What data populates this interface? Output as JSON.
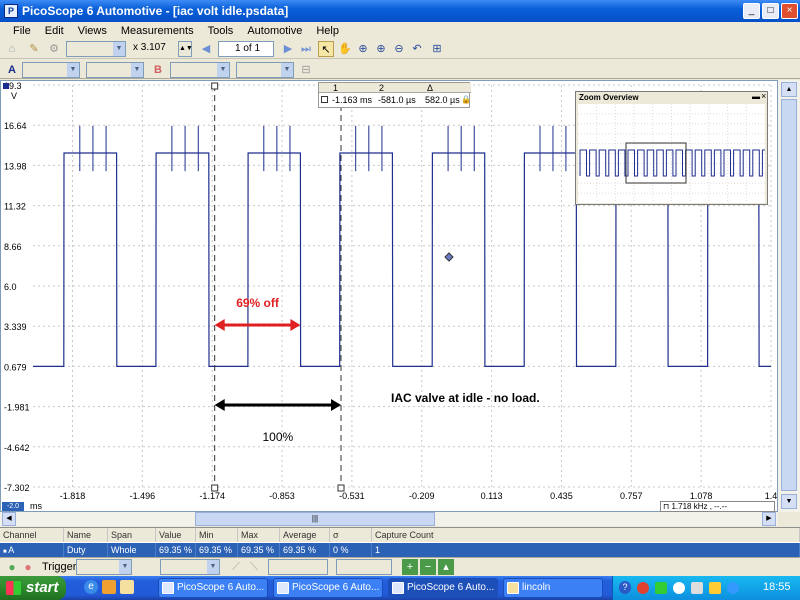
{
  "window": {
    "title": "PicoScope 6 Automotive - [iac volt idle.psdata]",
    "min_label": "_",
    "max_label": "□",
    "close_label": "×"
  },
  "menu": {
    "items": [
      "File",
      "Edit",
      "Views",
      "Measurements",
      "Tools",
      "Automotive",
      "Help"
    ]
  },
  "toolbar": {
    "zoom_value": "x 3.107",
    "page_value": "1 of 1",
    "channel_a": "A",
    "channel_b": "B"
  },
  "plot": {
    "channel_label": "A",
    "unit_label": "V",
    "time_unit": "ms",
    "y_tick_labels": [
      "19.3",
      "16.64",
      "13.98",
      "11.32",
      "8.66",
      "6.0",
      "3.339",
      "0.679",
      "-1.981",
      "-4.642",
      "-7.302"
    ],
    "x_tick_labels": [
      "-1.818",
      "-1.496",
      "-1.174",
      "-0.853",
      "-0.531",
      "-0.209",
      "0.113",
      "0.435",
      "0.757",
      "1.078",
      "1.4"
    ],
    "x_start_label": "-2.0",
    "frequency_readout": "1.718 kHz , --.--",
    "annotation_off": "69% off",
    "annotation_period": "100%",
    "annotation_note": "IAC valve at idle - no load."
  },
  "ruler_panel": {
    "headers": [
      "1",
      "2",
      "Δ"
    ],
    "values": [
      "-1.163 ms",
      "-581.0 µs",
      "582.0 µs"
    ]
  },
  "zoom_overview": {
    "title": "Zoom Overview"
  },
  "measurements_table": {
    "headers": [
      "Channel",
      "Name",
      "Span",
      "Value",
      "Min",
      "Max",
      "Average",
      "σ",
      "Capture Count"
    ],
    "row": [
      "A",
      "Duty Cycle",
      "Whole trace",
      "69.35 %",
      "69.35 %",
      "69.35 %",
      "69.35 %",
      "0 %",
      "1"
    ]
  },
  "trigger": {
    "label": "Trigger"
  },
  "taskbar": {
    "start_label": "start",
    "tasks": [
      "PicoScope 6 Auto...",
      "PicoScope 6 Auto...",
      "PicoScope 6 Auto...",
      "lincoln"
    ],
    "clock": "18:55"
  },
  "chart_data": {
    "type": "line",
    "title": "",
    "xlabel": "ms",
    "ylabel": "V",
    "xlim": [
      -2.0,
      1.4
    ],
    "ylim": [
      -7.302,
      19.3
    ],
    "grid": true,
    "series": [
      {
        "color": "#1f2f8f",
        "x": [
          -2.0,
          -1.858,
          -1.857,
          -1.615,
          -1.614,
          -1.434,
          -1.433,
          -1.19,
          -1.189,
          -1.01,
          -1.009,
          -0.768,
          -0.767,
          -0.587,
          -0.586,
          -0.344,
          -0.343,
          -0.161,
          -0.16,
          0.081,
          0.082,
          0.263,
          0.264,
          0.503,
          0.504,
          0.685,
          0.686,
          0.925,
          0.926,
          1.108,
          1.109,
          1.344,
          1.345,
          1.4
        ],
        "y": [
          0.68,
          0.68,
          14.8,
          14.8,
          0.68,
          0.68,
          14.8,
          14.8,
          0.68,
          0.68,
          14.8,
          14.8,
          0.68,
          0.68,
          14.8,
          14.8,
          0.68,
          0.68,
          14.8,
          14.8,
          0.68,
          0.68,
          14.8,
          14.8,
          0.68,
          0.68,
          14.8,
          14.8,
          0.68,
          0.68,
          14.8,
          14.8,
          0.68,
          0.68
        ]
      }
    ],
    "cursors_x": [
      -1.163,
      -0.581
    ]
  }
}
